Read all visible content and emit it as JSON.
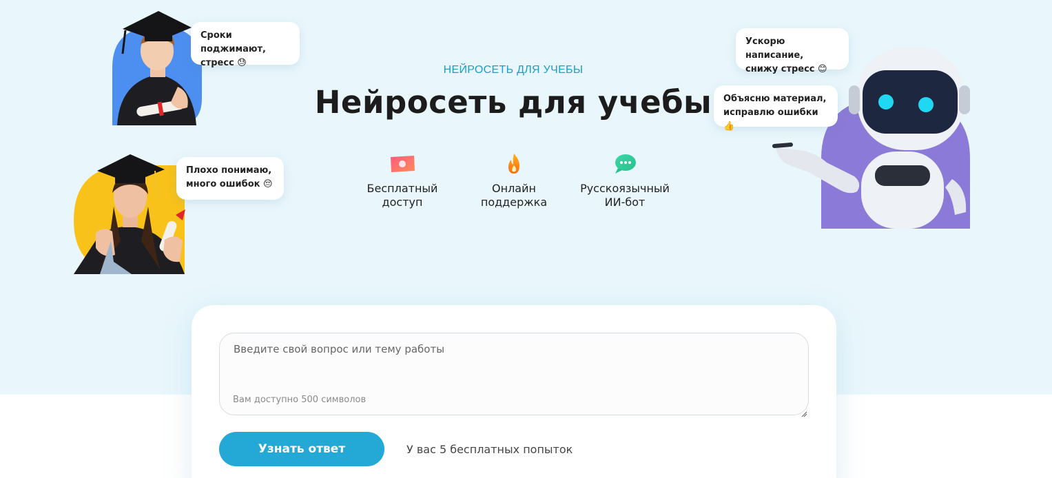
{
  "hero": {
    "eyebrow": "НЕЙРОСЕТЬ ДЛЯ УЧЕБЫ",
    "title": "Нейросеть для учебы",
    "features": [
      {
        "icon": "ticket-icon",
        "label": "Бесплатный\nдоступ"
      },
      {
        "icon": "flame-icon",
        "label": "Онлайн\nподдержка"
      },
      {
        "icon": "chat-bubble-icon",
        "label": "Русскоязычный\nИИ-бот"
      }
    ]
  },
  "bubbles": {
    "student_male": "Сроки поджимают,\nстресс 😓",
    "student_female": "Плохо понимаю,\nмного ошибок 😔",
    "robot_top": "Ускорю написание,\nснижу стресс 😊",
    "robot_bottom": "Объясню материал,\nисправлю ошибки 👍"
  },
  "form": {
    "placeholder": "Введите свой вопрос или тему работы",
    "limit_text": "Вам доступно 500 символов",
    "submit_label": "Узнать ответ",
    "attempts_text": "У вас 5 бесплатных попыток"
  },
  "colors": {
    "hero_bg": "#e9f7fc",
    "accent": "#24a9d6",
    "eyebrow": "#1a9dc9",
    "blob_blue": "#4d8ff0",
    "blob_yellow": "#f9c21a",
    "blob_purple": "#8c7ad8"
  }
}
